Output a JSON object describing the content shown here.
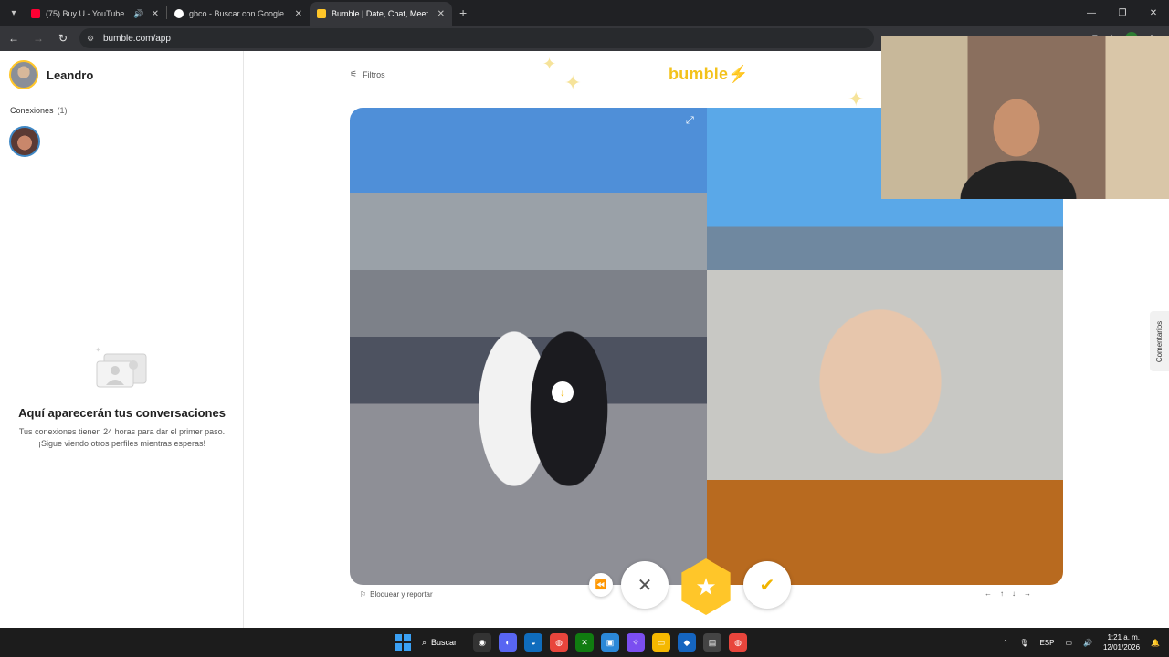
{
  "browser": {
    "tabs": [
      {
        "title": "(75) Buy U - YouTube",
        "favicon_color": "#ff0033",
        "active": false
      },
      {
        "title": "gbco - Buscar con Google",
        "favicon_color": "#ffffff",
        "active": false
      },
      {
        "title": "Bumble | Date, Chat, Meet New",
        "favicon_color": "#ffc629",
        "active": true
      }
    ],
    "new_tab": "+",
    "url": "bumble.com/app"
  },
  "sidebar": {
    "user_name": "Leandro",
    "connections_label": "Conexiones",
    "connections_count": "(1)",
    "empty_title": "Aquí aparecerán tus conversaciones",
    "empty_line1": "Tus conexiones tienen 24 horas para dar el primer paso.",
    "empty_line2": "¡Sigue viendo otros perfiles mientras esperas!"
  },
  "main": {
    "filters_label": "Filtros",
    "logo_text": "bumble",
    "report_label": "Bloquear y reportar",
    "side_tab_label": "Comentarios",
    "hints": [
      "←",
      "↑",
      "↓",
      "→"
    ]
  },
  "taskbar": {
    "search_label": "Buscar",
    "language": "ESP",
    "time": "1:21 a. m.",
    "date": "12/01/2026"
  },
  "colors": {
    "brand": "#ffc629",
    "chrome_bg": "#202124"
  }
}
